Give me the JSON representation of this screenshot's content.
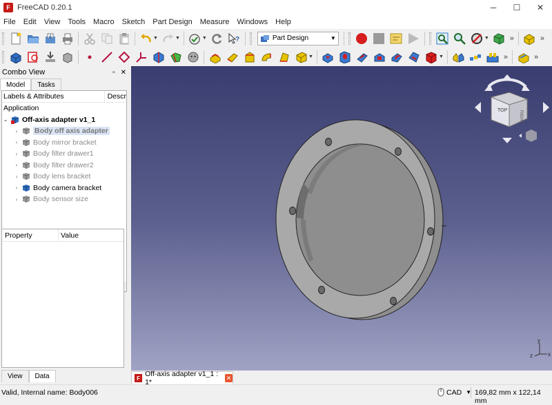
{
  "window": {
    "title": "FreeCAD 0.20.1",
    "app_icon": "freecad-logo-icon",
    "min": "─",
    "max": "☐",
    "close": "✕"
  },
  "menu": [
    "File",
    "Edit",
    "View",
    "Tools",
    "Macro",
    "Sketch",
    "Part Design",
    "Measure",
    "Windows",
    "Help"
  ],
  "toolbar": {
    "workbench": "Part Design",
    "more": "»"
  },
  "combo_view": {
    "title": "Combo View",
    "float": "▫",
    "close": "✕",
    "tabs": [
      "Model",
      "Tasks"
    ],
    "tree_columns": [
      "Labels & Attributes",
      "Descr"
    ],
    "root": "Application",
    "document": "Off-axis adapter v1_1",
    "bodies": [
      {
        "label": "Body off axis adapter",
        "state": "selected"
      },
      {
        "label": "Body mirror bracket",
        "state": "hidden"
      },
      {
        "label": "Body filter drawer1",
        "state": "hidden"
      },
      {
        "label": "Body filter drawer2",
        "state": "hidden"
      },
      {
        "label": "Body lens bracket",
        "state": "hidden"
      },
      {
        "label": "Body camera bracket",
        "state": "active"
      },
      {
        "label": "Body sensor size",
        "state": "hidden"
      }
    ],
    "property_columns": [
      "Property",
      "Value"
    ],
    "bottom_tabs": [
      "View",
      "Data"
    ]
  },
  "navcube": {
    "face_top": "TOP",
    "face_right": "RIGHT"
  },
  "axes": {
    "x": "x",
    "y": "y",
    "z": "z"
  },
  "document_tab": {
    "label": "Off-axis adapter v1_1 : 1*",
    "close": "✕"
  },
  "status": {
    "message": "Valid, Internal name: Body006",
    "nav_style": "CAD",
    "dimensions": "169,82 mm x 122,14 mm"
  },
  "colors": {
    "viewport_top": "#393d6f",
    "viewport_bottom": "#a0a3c4",
    "part": "#a8a8a8",
    "record": "#d61e1e"
  }
}
